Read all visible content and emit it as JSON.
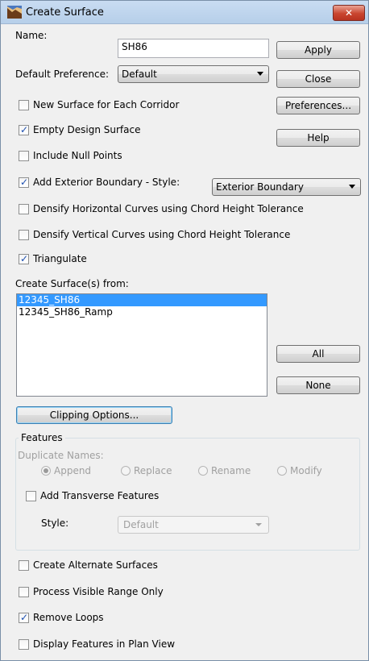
{
  "window": {
    "title": "Create Surface",
    "close_glyph": "✕",
    "icon": "surface-app-icon"
  },
  "form": {
    "name_label": "Name:",
    "name_value": "SH86",
    "pref_label": "Default Preference:",
    "pref_value": "Default"
  },
  "buttons": {
    "apply": "Apply",
    "close": "Close",
    "preferences": "Preferences...",
    "help": "Help",
    "all": "All",
    "none": "None",
    "clipping": "Clipping Options..."
  },
  "options": [
    {
      "label": "New Surface for Each Corridor",
      "checked": false
    },
    {
      "label": "Empty Design Surface",
      "checked": true
    },
    {
      "label": "Include Null Points",
      "checked": false
    },
    {
      "label": "Add Exterior Boundary - Style:",
      "checked": true
    },
    {
      "label": "Densify Horizontal Curves using Chord Height Tolerance",
      "checked": false
    },
    {
      "label": "Densify Vertical Curves using Chord Height Tolerance",
      "checked": false
    },
    {
      "label": "Triangulate",
      "checked": true
    }
  ],
  "boundary_style": "Exterior Boundary",
  "surfaces_from": {
    "label": "Create Surface(s) from:",
    "items": [
      {
        "label": "12345_SH86",
        "selected": true
      },
      {
        "label": "12345_SH86_Ramp",
        "selected": false
      }
    ]
  },
  "features": {
    "legend": "Features",
    "duplicate_label": "Duplicate Names:",
    "radios": [
      {
        "label": "Append",
        "selected": true
      },
      {
        "label": "Replace",
        "selected": false
      },
      {
        "label": "Rename",
        "selected": false
      },
      {
        "label": "Modify",
        "selected": false
      }
    ],
    "add_transverse": {
      "label": "Add Transverse Features",
      "checked": false
    },
    "style_label": "Style:",
    "style_value": "Default"
  },
  "bottom_options": [
    {
      "label": "Create Alternate Surfaces",
      "checked": false
    },
    {
      "label": "Process Visible Range Only",
      "checked": false
    },
    {
      "label": "Remove Loops",
      "checked": true
    },
    {
      "label": "Display Features in Plan View",
      "checked": false
    }
  ],
  "colors": {
    "selection": "#3399ff",
    "check": "#1c4fb0",
    "close_button": "#c9452f"
  }
}
